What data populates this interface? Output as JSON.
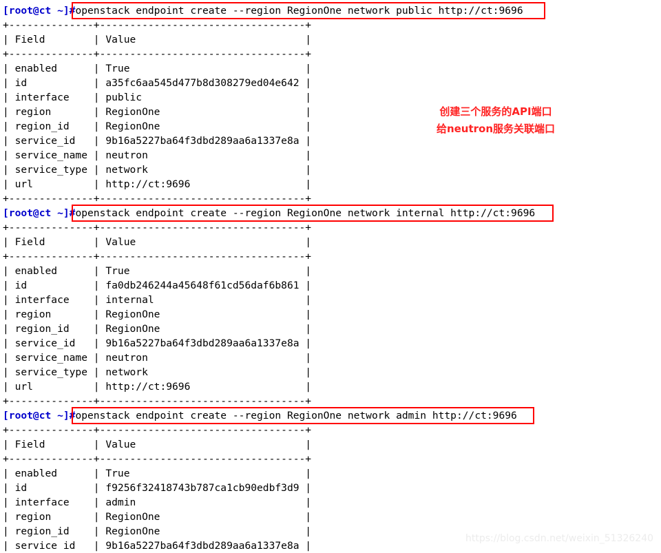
{
  "terminal": {
    "prompt": "[root@ct ~]#",
    "separator": "+--------------+----------------------------------+",
    "header_row": "| Field        | Value                            |",
    "blocks": [
      {
        "command": "openstack endpoint create --region RegionOne network public http://ct:9696",
        "rows": [
          "| enabled      | True                             |",
          "| id           | a35fc6aa545d477b8d308279ed04e642 |",
          "| interface    | public                           |",
          "| region       | RegionOne                        |",
          "| region_id    | RegionOne                        |",
          "| service_id   | 9b16a5227ba64f3dbd289aa6a1337e8a |",
          "| service_name | neutron                          |",
          "| service_type | network                          |",
          "| url          | http://ct:9696                   |"
        ]
      },
      {
        "command": "openstack endpoint create --region RegionOne network internal http://ct:9696",
        "rows": [
          "| enabled      | True                             |",
          "| id           | fa0db246244a45648f61cd56daf6b861 |",
          "| interface    | internal                         |",
          "| region       | RegionOne                        |",
          "| region_id    | RegionOne                        |",
          "| service_id   | 9b16a5227ba64f3dbd289aa6a1337e8a |",
          "| service_name | neutron                          |",
          "| service_type | network                          |",
          "| url          | http://ct:9696                   |"
        ]
      },
      {
        "command": "openstack endpoint create --region RegionOne network admin http://ct:9696",
        "rows": [
          "| enabled      | True                             |",
          "| id           | f9256f32418743b787ca1cb90edbf3d9 |",
          "| interface    | admin                            |",
          "| region       | RegionOne                        |",
          "| region_id    | RegionOne                        |",
          "| service id   | 9b16a5227ba64f3dbd289aa6a1337e8a |"
        ]
      }
    ]
  },
  "annotation": {
    "line1": "创建三个服务的API端口",
    "line2": "给neutron服务关联端口",
    "color": "#ff2222"
  },
  "watermark": {
    "text": "https://blog.csdn.net/weixin_51326240"
  },
  "colors": {
    "prompt": "#0000cc",
    "command_text": "#000000",
    "highlight_box": "#ff0000",
    "table_text": "#000000",
    "background": "#ffffff"
  }
}
